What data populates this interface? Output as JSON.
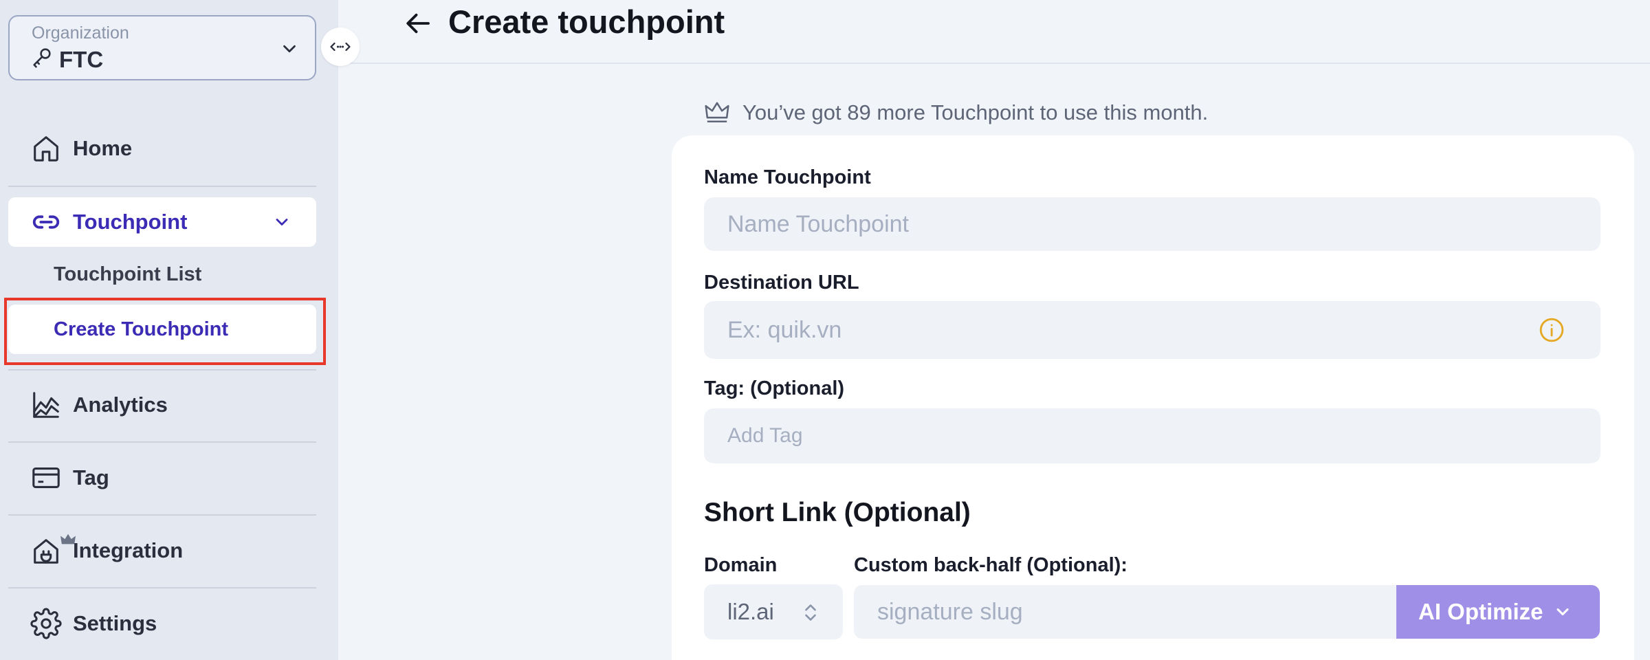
{
  "organization": {
    "caption": "Organization",
    "value": "FTC"
  },
  "sidebar": {
    "items": [
      {
        "label": "Home",
        "icon": "home-icon"
      },
      {
        "label": "Touchpoint",
        "icon": "link-icon"
      },
      {
        "label": "Analytics",
        "icon": "chart-icon"
      },
      {
        "label": "Tag",
        "icon": "card-icon"
      },
      {
        "label": "Integration",
        "icon": "plug-icon"
      },
      {
        "label": "Settings",
        "icon": "gear-icon"
      }
    ],
    "sub_items": [
      {
        "label": "Touchpoint List"
      },
      {
        "label": "Create Touchpoint"
      }
    ]
  },
  "header": {
    "title": "Create touchpoint"
  },
  "quota": {
    "text": "You’ve got 89 more Touchpoint to use this month."
  },
  "form": {
    "name_label": "Name Touchpoint",
    "name_placeholder": "Name Touchpoint",
    "url_label": "Destination URL",
    "url_placeholder": "Ex: quik.vn",
    "tag_label": "Tag: (Optional)",
    "tag_placeholder": "Add Tag",
    "short_link_title": "Short Link (Optional)",
    "domain_label": "Domain",
    "domain_value": "li2.ai",
    "custom_label": "Custom back-half (Optional):",
    "custom_placeholder": "signature slug",
    "ai_button": "AI Optimize"
  },
  "colors": {
    "accent": "#3b2bb5",
    "ai_button": "#a08fe6",
    "highlight": "#e8382b",
    "info": "#e5a822"
  }
}
